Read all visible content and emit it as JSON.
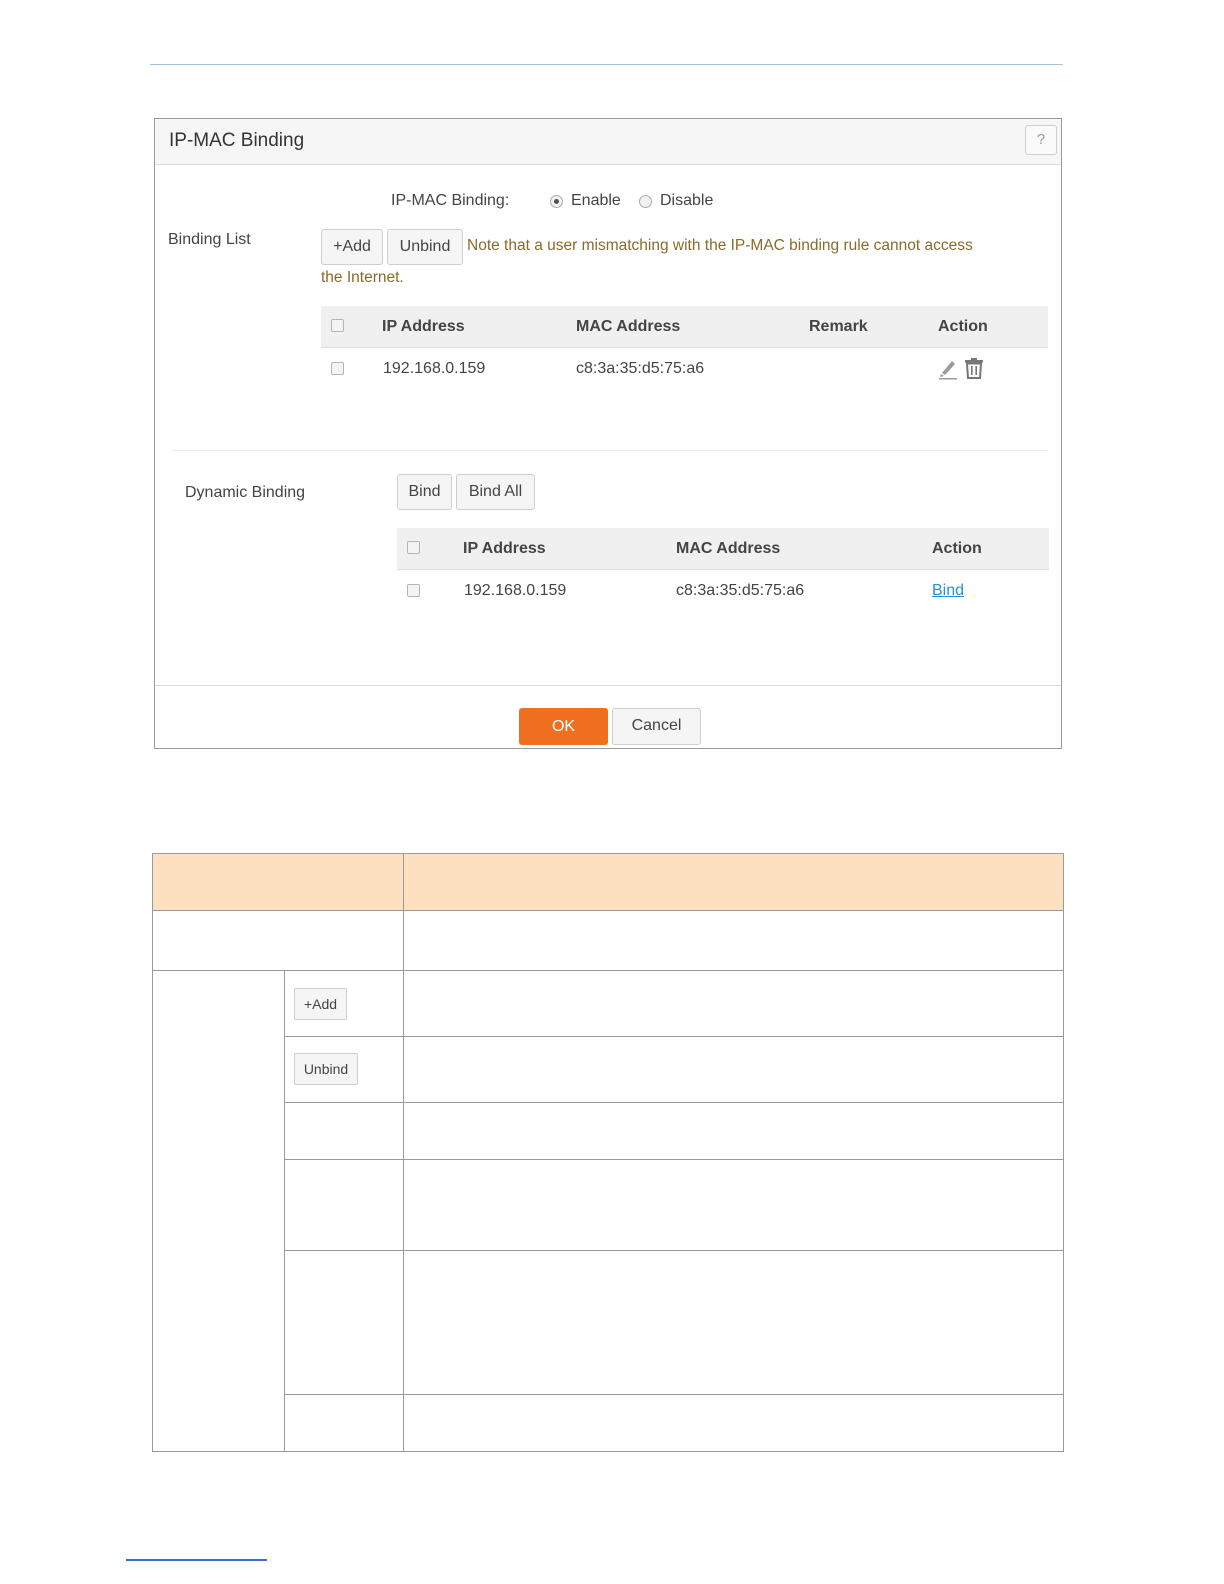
{
  "dialog": {
    "title": "IP-MAC Binding",
    "help_label": "?",
    "binding_toggle": {
      "label": "IP-MAC Binding:",
      "enable_label": "Enable",
      "disable_label": "Disable",
      "selected": "Enable"
    },
    "binding_list": {
      "label": "Binding List",
      "add_label": "+Add",
      "unbind_label": "Unbind",
      "note_line1": "Note that a user mismatching with the IP-MAC binding rule cannot access",
      "note_line2": "the Internet.",
      "columns": [
        "IP Address",
        "MAC Address",
        "Remark",
        "Action"
      ],
      "rows": [
        {
          "ip": "192.168.0.159",
          "mac": "c8:3a:35:d5:75:a6",
          "remark": ""
        }
      ]
    },
    "dynamic_binding": {
      "label": "Dynamic Binding",
      "bind_label": "Bind",
      "bind_all_label": "Bind All",
      "columns": [
        "IP Address",
        "MAC Address",
        "Action"
      ],
      "rows": [
        {
          "ip": "192.168.0.159",
          "mac": "c8:3a:35:d5:75:a6",
          "action": "Bind"
        }
      ]
    },
    "ok_label": "OK",
    "cancel_label": "Cancel"
  },
  "desc_table": {
    "add_label": "+Add",
    "unbind_label": "Unbind"
  },
  "colors": {
    "accent": "#f07020",
    "note_text": "#8a6a2a",
    "link": "#2a8fd6",
    "table_header": "#fde0c0"
  },
  "icons": [
    "help-icon",
    "edit-icon",
    "delete-icon"
  ]
}
